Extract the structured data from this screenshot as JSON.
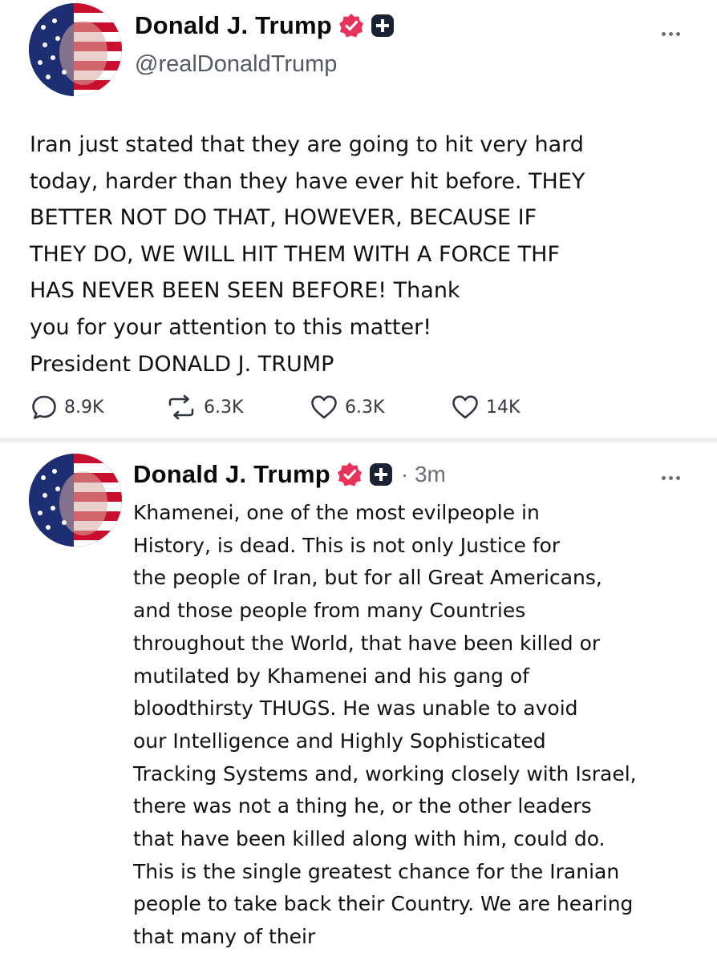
{
  "posts": [
    {
      "author": {
        "display_name": "Donald J. Trump",
        "handle": "@realDonaldTrump",
        "verified_icon": "verified-badge-icon",
        "badge_icon": "plus-badge-icon"
      },
      "body": "Iran just stated that they are going to hit very hard\ntoday, harder than they have ever hit before. THEY\nBETTER NOT DO THAT, HOWEVER, BECAUSE IF\nTHEY DO, WE WILL HIT THEM WITH A FORCE THF\nHAS NEVER BEEN SEEN BEFORE! Thank\nyou for your attention to this matter!\nPresident DONALD J. TRUMP",
      "actions": {
        "replies": "8.9K",
        "retruths": "6.3K",
        "likes": "6.3K",
        "likes_2": "14K"
      }
    },
    {
      "author": {
        "display_name": "Donald J. Trump",
        "verified_icon": "verified-badge-icon",
        "badge_icon": "plus-badge-icon"
      },
      "timestamp": "· 3m",
      "body": "Khamenei, one of the most evilpeople in\nHistory, is dead. This is not only Justice for\nthe people of Iran, but for all Great Americans,\nand those people from many Countries\nthroughout the World, that have been killed or\nmutilated by Khamenei and his gang of\nbloodthirsty THUGS. He was unable to avoid\nour Intelligence and Highly Sophisticated\nTracking Systems and, working closely with Israel,\nthere was not a thing he, or the other leaders\nthat have been killed along with him, could do.\nThis is the single greatest chance for the Iranian\npeople to take back their Country. We are hearing\nthat many of their"
    }
  ],
  "colors": {
    "verified": "#e8315b",
    "text": "#0f1419",
    "muted": "#6b6f75",
    "divider": "#eeeeee"
  }
}
